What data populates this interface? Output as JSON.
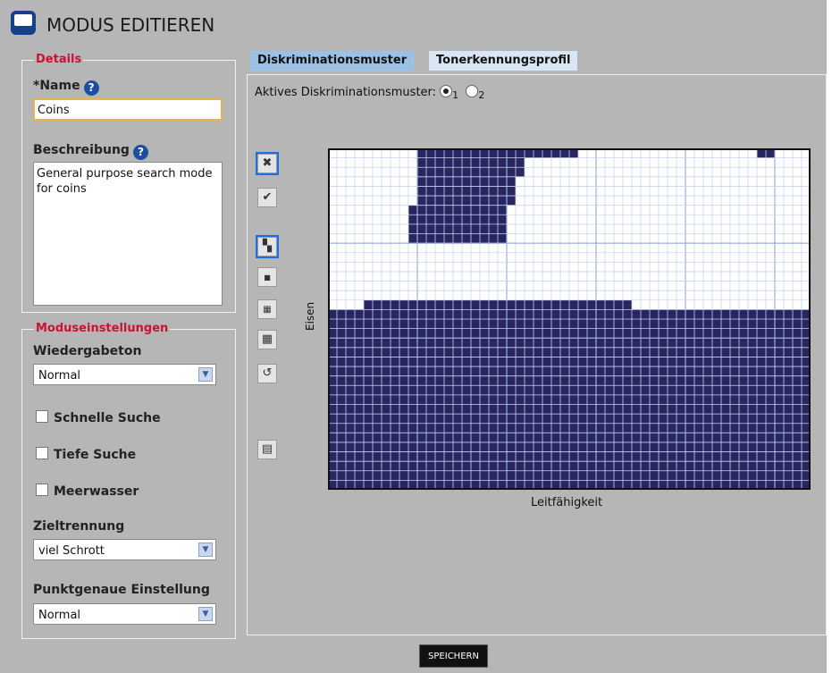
{
  "header": {
    "title": "MODUS EDITIEREN"
  },
  "details": {
    "legend": "Details",
    "name_label": "*Name",
    "name_value": "Coins",
    "description_label": "Beschreibung",
    "description_value": "General purpose search mode for coins"
  },
  "mode_settings": {
    "legend": "Moduseinstellungen",
    "audio_label": "Wiedergabeton",
    "audio_value": "Normal",
    "fast_search": "Schnelle Suche",
    "deep_search": "Tiefe Suche",
    "seawater": "Meerwasser",
    "target_sep_label": "Zieltrennung",
    "target_sep_value": "viel Schrott",
    "pinpoint_label": "Punktgenaue Einstellung",
    "pinpoint_value": "Normal"
  },
  "tabs": [
    {
      "label": "Diskriminationsmuster",
      "active": true
    },
    {
      "label": "Tonerkennungsprofil",
      "active": false
    }
  ],
  "pattern": {
    "active_label": "Aktives Diskriminationsmuster:",
    "options": [
      "1",
      "2"
    ],
    "selected": "1",
    "ylabel": "Eisen",
    "xlabel": "Leitfähigkeit"
  },
  "toolbar": {
    "tools": [
      "clear-icon",
      "accept-icon",
      "pen-icon",
      "small-brush-icon",
      "medium-brush-icon",
      "large-brush-icon",
      "undo-icon",
      "grid-icon"
    ]
  },
  "save_label": "SPEICHERN",
  "colors": {
    "fill": "#272660",
    "accent_red": "#cc1133",
    "tab_active": "#9bc1e7"
  }
}
